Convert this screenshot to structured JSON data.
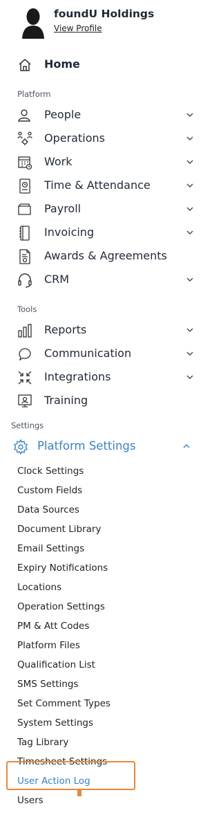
{
  "profile": {
    "org_name": "foundU Holdings",
    "link_label": "View Profile"
  },
  "home": {
    "label": "Home",
    "icon": "home-icon"
  },
  "sections": {
    "platform": "Platform",
    "tools": "Tools",
    "settings": "Settings"
  },
  "platform_items": [
    {
      "label": "People",
      "icon": "people-icon",
      "expandable": true
    },
    {
      "label": "Operations",
      "icon": "operations-icon",
      "expandable": true
    },
    {
      "label": "Work",
      "icon": "calendar-icon",
      "expandable": true
    },
    {
      "label": "Time & Attendance",
      "icon": "timesheet-icon",
      "expandable": true
    },
    {
      "label": "Payroll",
      "icon": "wallet-icon",
      "expandable": true
    },
    {
      "label": "Invoicing",
      "icon": "invoice-icon",
      "expandable": true
    },
    {
      "label": "Awards & Agreements",
      "icon": "award-document-icon",
      "expandable": false
    },
    {
      "label": "CRM",
      "icon": "headset-icon",
      "expandable": true
    }
  ],
  "tools_items": [
    {
      "label": "Reports",
      "icon": "bar-chart-icon",
      "expandable": true
    },
    {
      "label": "Communication",
      "icon": "chat-icon",
      "expandable": true
    },
    {
      "label": "Integrations",
      "icon": "integrations-icon",
      "expandable": true
    },
    {
      "label": "Training",
      "icon": "training-icon",
      "expandable": false
    }
  ],
  "platform_settings": {
    "label": "Platform Settings",
    "icon": "gear-icon",
    "expanded": true
  },
  "settings_items": [
    "Clock Settings",
    "Custom Fields",
    "Data Sources",
    "Document Library",
    "Email Settings",
    "Expiry Notifications",
    "Locations",
    "Operation Settings",
    "PM & Att Codes",
    "Platform Files",
    "Qualification List",
    "SMS Settings",
    "Set Comment Types",
    "System Settings",
    "Tag Library",
    "Timesheet Settings",
    "User Action Log",
    "Users"
  ],
  "active_item": "User Action Log",
  "colors": {
    "accent": "#3b82c4",
    "highlight": "#e8883a",
    "text": "#1f2937"
  }
}
